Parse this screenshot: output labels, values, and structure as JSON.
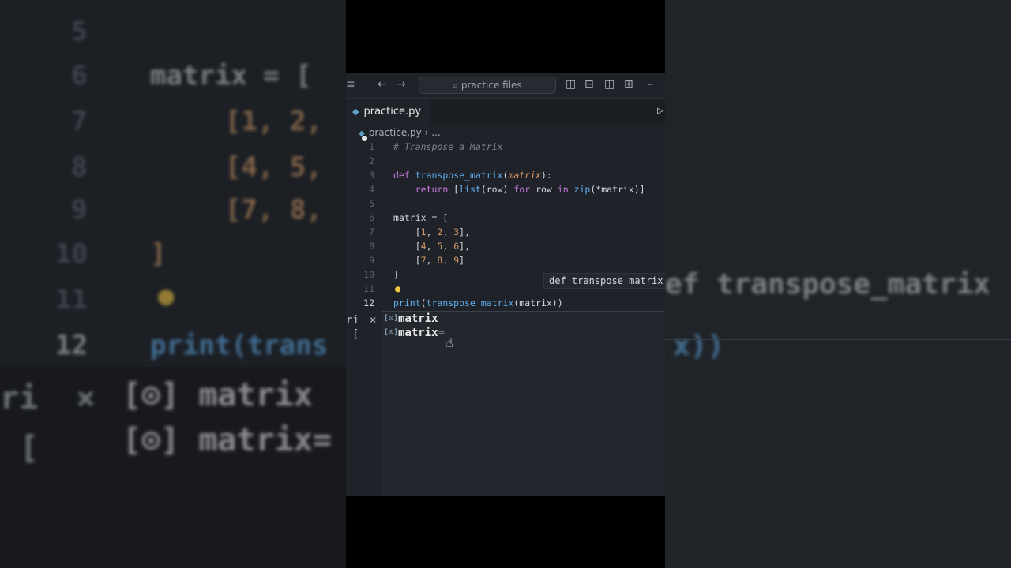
{
  "titlebar": {
    "menu_icon": "menu-icon",
    "search_placeholder": "practice files"
  },
  "tab": {
    "filename": "practice.py",
    "modified": true
  },
  "breadcrumb": {
    "file": "practice.py",
    "more": "..."
  },
  "code_lines": [
    {
      "n": "1",
      "text": "# Transpose a Matrix"
    },
    {
      "n": "2",
      "text": ""
    },
    {
      "n": "3",
      "text": "def transpose_matrix(matrix):"
    },
    {
      "n": "4",
      "text": "    return [list(row) for row in zip(*matrix)]"
    },
    {
      "n": "5",
      "text": ""
    },
    {
      "n": "6",
      "text": "matrix = ["
    },
    {
      "n": "7",
      "text": "    [1, 2, 3],"
    },
    {
      "n": "8",
      "text": "    [4, 5, 6],"
    },
    {
      "n": "9",
      "text": "    [7, 8, 9]"
    },
    {
      "n": "10",
      "text": "]"
    },
    {
      "n": "11",
      "text": ""
    },
    {
      "n": "12",
      "text": "print(transpose_matrix(matrix))"
    }
  ],
  "hover_hint": "def transpose_matrix",
  "suggestions": [
    {
      "label": "matrix",
      "suffix": ""
    },
    {
      "label": "matrix",
      "suffix": "="
    }
  ],
  "left_strip": {
    "close": "×",
    "text": "ri",
    "bracket": "["
  },
  "colors": {
    "editor_bg": "#1f2329",
    "keyword": "#c678dd",
    "function": "#61afef",
    "comment": "#7f848e",
    "parameter": "#e5a05c",
    "number": "#d19a66",
    "bulb": "#f2c744"
  }
}
